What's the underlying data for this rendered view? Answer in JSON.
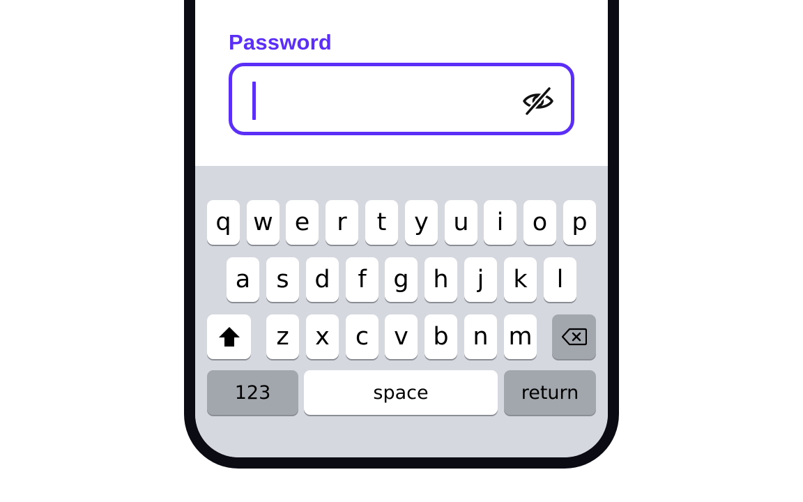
{
  "form": {
    "password_label": "Password",
    "password_value": "",
    "toggle_icon": "eye-off-icon"
  },
  "keyboard": {
    "row1": [
      "q",
      "w",
      "e",
      "r",
      "t",
      "y",
      "u",
      "i",
      "o",
      "p"
    ],
    "row2": [
      "a",
      "s",
      "d",
      "f",
      "g",
      "h",
      "j",
      "k",
      "l"
    ],
    "row3": [
      "z",
      "x",
      "c",
      "v",
      "b",
      "n",
      "m"
    ],
    "shift_icon": "shift-icon",
    "backspace_icon": "backspace-icon",
    "numbers_label": "123",
    "space_label": "space",
    "return_label": "return"
  },
  "colors": {
    "accent": "#5b2ff5",
    "keyboard_bg": "#d5d8de",
    "key_bg": "#ffffff",
    "function_key_bg": "#a2a6ad",
    "device_frame": "#0b0b14"
  }
}
